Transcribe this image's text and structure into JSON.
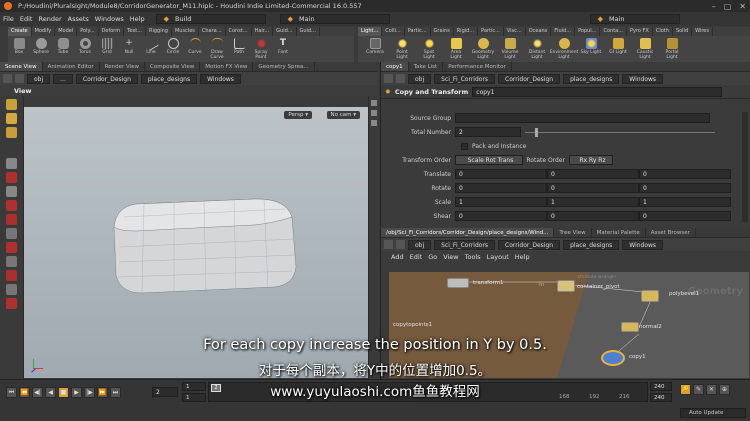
{
  "window": {
    "title": "P:/Houdini/Pluralsight/Module8/CorridorGenerator_M11.hiplc - Houdini Indie Limited-Commercial 16.0.557",
    "menu": [
      "File",
      "Edit",
      "Render",
      "Assets",
      "Windows",
      "Help"
    ],
    "desktop_left": "Build",
    "desktop_right": "Main"
  },
  "shelf_left": {
    "tabs": [
      "Create",
      "Modify",
      "Model",
      "Poly...",
      "Deform",
      "Text...",
      "Rigging",
      "Muscles",
      "Chara...",
      "Const...",
      "Hair...",
      "Guid...",
      "Guid..."
    ],
    "tools": [
      "Box",
      "Sphere",
      "Tube",
      "Torus",
      "Grid",
      "Null",
      "Line",
      "Circle",
      "Curve",
      "Draw Curve",
      "Path",
      "Spray Paint",
      "Font"
    ]
  },
  "shelf_right": {
    "tabs": [
      "Light...",
      "Colli...",
      "Partic...",
      "Grains",
      "Rigid...",
      "Partic...",
      "Visc...",
      "Oceans",
      "Fluid...",
      "Popul...",
      "Conta...",
      "Pyro FX",
      "Cloth",
      "Solid",
      "Wires"
    ],
    "tools": [
      "Camera",
      "Point Light",
      "Spot Light",
      "Area Light",
      "Geometry Light",
      "Volume Light",
      "Distant Light",
      "Environment Light",
      "Sky Light",
      "GI Light",
      "Caustic Light",
      "Portal Light"
    ]
  },
  "viewport": {
    "tabs": [
      "Scene View",
      "Animation Editor",
      "Render View",
      "Composite View",
      "Motion FX View",
      "Geometry Sprea..."
    ],
    "path": [
      "obj",
      "...",
      "Corridor_Design",
      "place_designs",
      "Windows"
    ],
    "label": "View",
    "persp": "Persp",
    "cam": "No cam"
  },
  "params": {
    "tabs": [
      "copy1",
      "Take List",
      "Performance Monitor"
    ],
    "path": [
      "obj",
      "Sci_Fi_Corridors",
      "Corridor_Design",
      "place_designs",
      "Windows"
    ],
    "node_type": "Copy and Transform",
    "node_name": "copy1",
    "source_group_label": "Source Group",
    "source_group_value": "",
    "total_number_label": "Total Number",
    "total_number_value": "2",
    "pack_label": "Pack and Instance",
    "transform_order_label": "Transform Order",
    "transform_order_value": "Scale Rot Trans",
    "rotate_order_label": "Rotate Order",
    "rotate_order_value": "Rx Ry Rz",
    "rows": [
      {
        "label": "Translate",
        "values": [
          "0",
          "0",
          "0"
        ]
      },
      {
        "label": "Rotate",
        "values": [
          "0",
          "0",
          "0"
        ]
      },
      {
        "label": "Scale",
        "values": [
          "1",
          "1",
          "1"
        ]
      },
      {
        "label": "Shear",
        "values": [
          "0",
          "0",
          "0"
        ]
      }
    ]
  },
  "network": {
    "tabs": [
      "/obj/Sci_Fi_Corridors/Corridor_Design/place_designs/Wind...",
      "Tree View",
      "Material Palette",
      "Asset Browser"
    ],
    "path": [
      "obj",
      "Sci_Fi_Corridors",
      "Corridor_Design",
      "place_designs",
      "Windows"
    ],
    "menu": [
      "Add",
      "Edit",
      "Go",
      "View",
      "Tools",
      "Layout",
      "Help"
    ],
    "watermark": "Geometry",
    "nodes": [
      "transform1",
      "attribute wrangle",
      "container_pivot",
      "polybevel1",
      "normal2",
      "copy1",
      "copytopoints1"
    ],
    "in_label": "In"
  },
  "timeline": {
    "current_frame": "2",
    "start": "1",
    "start2": "1",
    "ticks": [
      "168",
      "192",
      "216"
    ],
    "end": "240",
    "end2": "240",
    "auto_update": "Auto Update"
  },
  "subtitles": {
    "en": "For each copy increase the position in Y by 0.5.",
    "zh": "对于每个副本，将Y中的位置增加0.5。",
    "site": "www.yuyulaoshi.com鱼鱼教程网"
  }
}
